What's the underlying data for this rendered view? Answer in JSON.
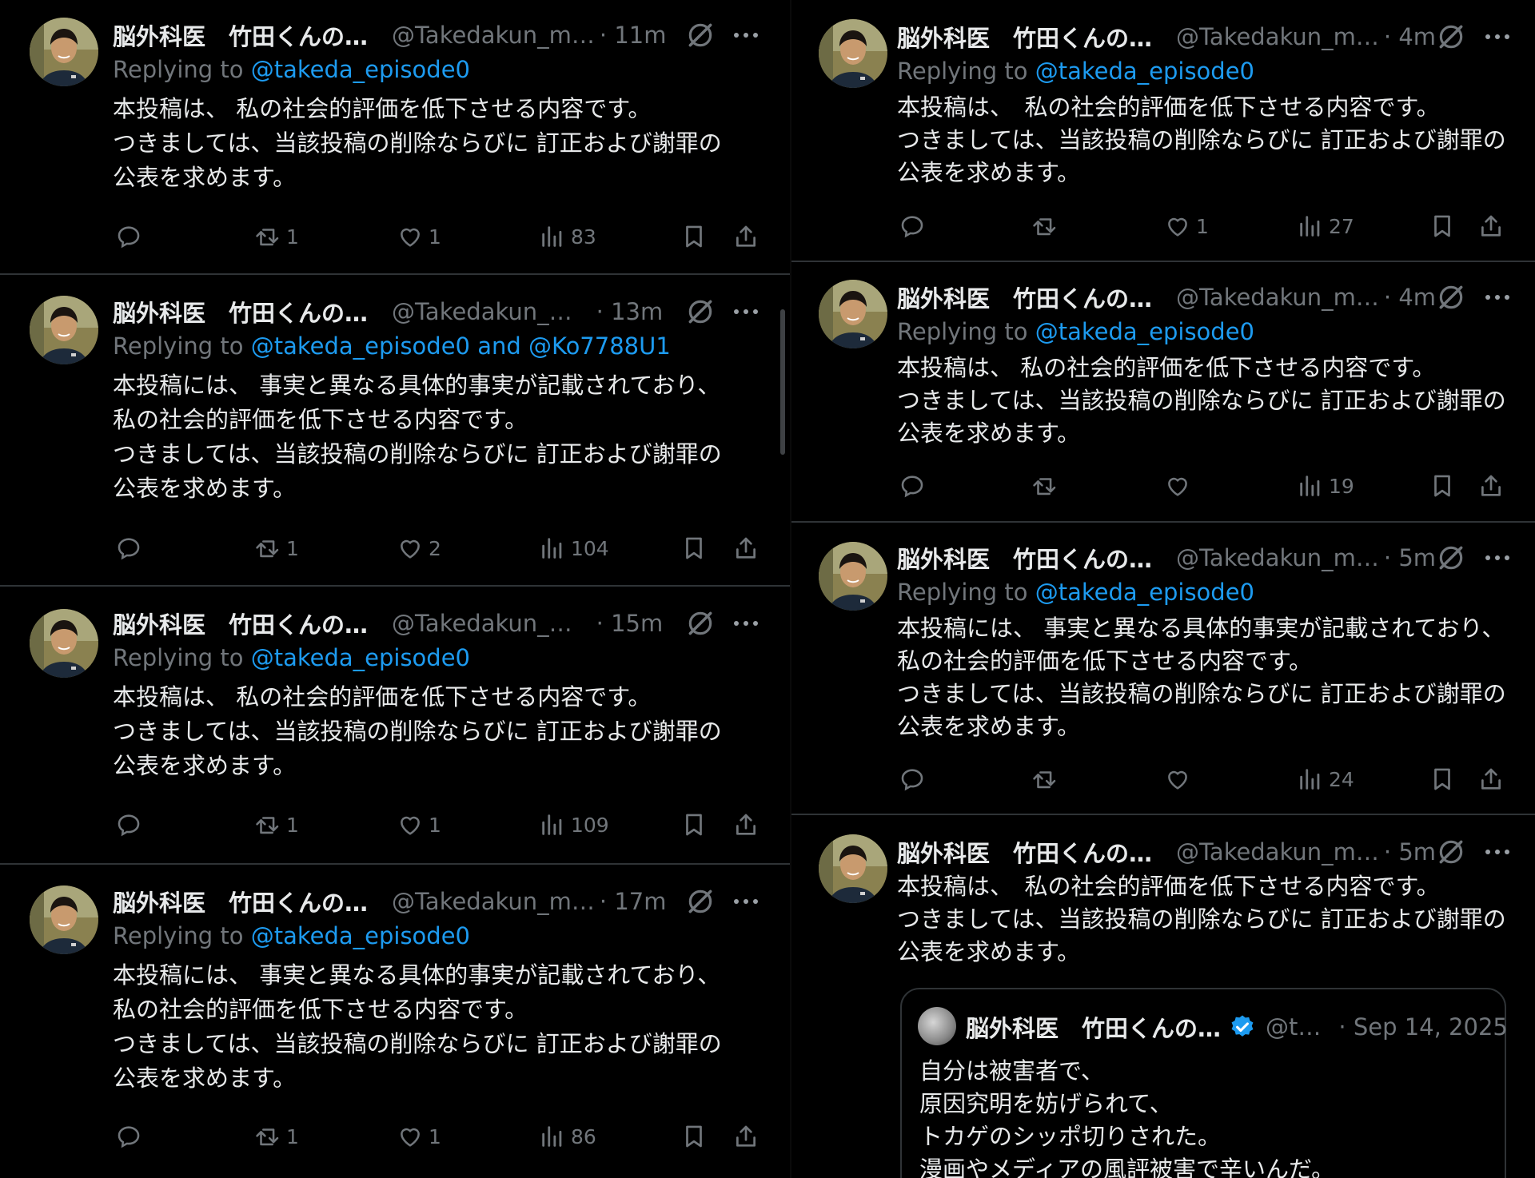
{
  "left": {
    "tweets": [
      {
        "name": "脳外科医　竹田くんの…",
        "handle": "@Takedakun_m…",
        "time": "· 11m",
        "reply_prefix": "Replying to ",
        "reply_to": "@takeda_episode0",
        "lines": [
          "本投稿は、 私の社会的評価を低下させる内容です。",
          "つきましては、当該投稿の削除ならびに 訂正および謝罪の",
          "公表を求めます。"
        ],
        "retweets": "1",
        "likes": "1",
        "views": "83"
      },
      {
        "name": "脳外科医　竹田くんの…",
        "handle": "@Takedakun_…",
        "time": "· 13m",
        "reply_prefix": "Replying to ",
        "reply_to": "@takeda_episode0 and @Ko7788U1",
        "lines": [
          "本投稿には、 事実と異なる具体的事実が記載されており、",
          "私の社会的評価を低下させる内容です。",
          "つきましては、当該投稿の削除ならびに 訂正および謝罪の",
          "公表を求めます。"
        ],
        "retweets": "1",
        "likes": "2",
        "views": "104"
      },
      {
        "name": "脳外科医　竹田くんの…",
        "handle": "@Takedakun_…",
        "time": "· 15m",
        "reply_prefix": "Replying to ",
        "reply_to": "@takeda_episode0",
        "lines": [
          "本投稿は、 私の社会的評価を低下させる内容です。",
          "つきましては、当該投稿の削除ならびに 訂正および謝罪の",
          "公表を求めます。"
        ],
        "retweets": "1",
        "likes": "1",
        "views": "109"
      },
      {
        "name": "脳外科医　竹田くんの…",
        "handle": "@Takedakun_m…",
        "time": "· 17m",
        "reply_prefix": "Replying to ",
        "reply_to": "@takeda_episode0",
        "lines": [
          "本投稿には、 事実と異なる具体的事実が記載されており、",
          "私の社会的評価を低下させる内容です。",
          "つきましては、当該投稿の削除ならびに 訂正および謝罪の",
          "公表を求めます。"
        ],
        "retweets": "1",
        "likes": "1",
        "views": "86"
      }
    ]
  },
  "right": {
    "tweets": [
      {
        "name": "脳外科医　竹田くんの…",
        "handle": "@Takedakun_m…",
        "time": "· 4m",
        "reply_prefix": "Replying to ",
        "reply_to": "@takeda_episode0",
        "lines": [
          "本投稿は、　私の社会的評価を低下させる内容です。",
          "つきましては、当該投稿の削除ならびに 訂正および謝罪の",
          "公表を求めます。"
        ],
        "likes": "1",
        "views": "27"
      },
      {
        "name": "脳外科医　竹田くんの…",
        "handle": "@Takedakun_m…",
        "time": "· 4m",
        "reply_prefix": "Replying to ",
        "reply_to": "@takeda_episode0",
        "lines": [
          "本投稿は、 私の社会的評価を低下させる内容です。",
          "つきましては、当該投稿の削除ならびに 訂正および謝罪の",
          "公表を求めます。"
        ],
        "views": "19"
      },
      {
        "name": "脳外科医　竹田くんの…",
        "handle": "@Takedakun_m…",
        "time": "· 5m",
        "reply_prefix": "Replying to ",
        "reply_to": "@takeda_episode0",
        "lines": [
          "本投稿には、 事実と異なる具体的事実が記載されており、",
          "私の社会的評価を低下させる内容です。",
          "つきましては、当該投稿の削除ならびに 訂正および謝罪の",
          "公表を求めます。"
        ],
        "views": "24"
      },
      {
        "name": "脳外科医　竹田くんの…",
        "handle": "@Takedakun_m…",
        "time": "· 5m",
        "lines": [
          "本投稿は、　私の社会的評価を低下させる内容です。",
          "つきましては、当該投稿の削除ならびに 訂正および謝罪の",
          "公表を求めます。"
        ],
        "quote": {
          "name": "脳外科医　竹田くんの…",
          "handle": "@t…",
          "date": "· Sep 14, 2025",
          "lines": [
            "自分は被害者で、",
            "原因究明を妨げられて、",
            "トカゲのシッポ切りされた。",
            "漫画やメディアの風評被害で辛いんだ。"
          ]
        }
      }
    ]
  },
  "icons": {
    "reply": "reply-bubble-icon",
    "retweet": "retweet-icon",
    "like": "heart-icon",
    "views": "views-bar-chart-icon",
    "bookmark": "bookmark-icon",
    "share": "share-icon",
    "grok": "grok-icon",
    "more": "more-dots-icon",
    "verified": "verified-badge-icon"
  },
  "colors": {
    "background": "#000000",
    "text": "#e7e9ea",
    "muted": "#71767b",
    "link": "#1d9bf0",
    "border": "#2f3336"
  }
}
